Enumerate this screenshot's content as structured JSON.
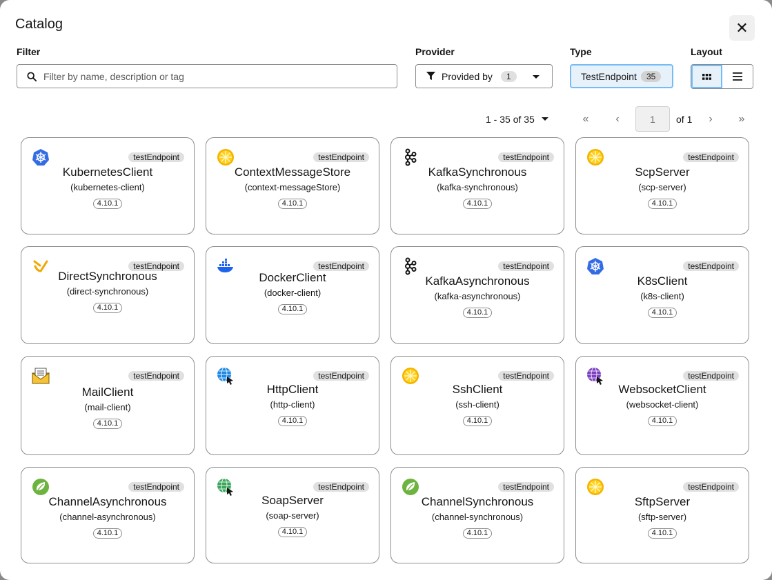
{
  "dialog": {
    "title": "Catalog",
    "close_glyph": "✕"
  },
  "filter": {
    "label": "Filter",
    "placeholder": "Filter by name, description or tag"
  },
  "provider": {
    "label": "Provider",
    "button_label": "Provided by",
    "count": "1"
  },
  "type": {
    "label": "Type",
    "selected": "TestEndpoint",
    "count": "35"
  },
  "layout": {
    "label": "Layout",
    "active": "grid"
  },
  "pagination": {
    "range": "1 - 35 of 35",
    "page": "1",
    "of_pages": "of 1",
    "first_glyph": "«",
    "prev_glyph": "‹",
    "next_glyph": "›",
    "last_glyph": "»"
  },
  "cards": [
    {
      "name": "KubernetesClient",
      "id": "(kubernetes-client)",
      "tag": "testEndpoint",
      "version": "4.10.1",
      "icon": "kubernetes-icon"
    },
    {
      "name": "ContextMessageStore",
      "id": "(context-messageStore)",
      "tag": "testEndpoint",
      "version": "4.10.1",
      "icon": "citrus-icon"
    },
    {
      "name": "KafkaSynchronous",
      "id": "(kafka-synchronous)",
      "tag": "testEndpoint",
      "version": "4.10.1",
      "icon": "kafka-icon"
    },
    {
      "name": "ScpServer",
      "id": "(scp-server)",
      "tag": "testEndpoint",
      "version": "4.10.1",
      "icon": "citrus-icon"
    },
    {
      "name": "DirectSynchronous",
      "id": "(direct-synchronous)",
      "tag": "testEndpoint",
      "version": "4.10.1",
      "icon": "direct-icon"
    },
    {
      "name": "DockerClient",
      "id": "(docker-client)",
      "tag": "testEndpoint",
      "version": "4.10.1",
      "icon": "docker-icon"
    },
    {
      "name": "KafkaAsynchronous",
      "id": "(kafka-asynchronous)",
      "tag": "testEndpoint",
      "version": "4.10.1",
      "icon": "kafka-icon"
    },
    {
      "name": "K8sClient",
      "id": "(k8s-client)",
      "tag": "testEndpoint",
      "version": "4.10.1",
      "icon": "kubernetes-icon"
    },
    {
      "name": "MailClient",
      "id": "(mail-client)",
      "tag": "testEndpoint",
      "version": "4.10.1",
      "icon": "mail-icon"
    },
    {
      "name": "HttpClient",
      "id": "(http-client)",
      "tag": "testEndpoint",
      "version": "4.10.1",
      "icon": "http-globe-icon"
    },
    {
      "name": "SshClient",
      "id": "(ssh-client)",
      "tag": "testEndpoint",
      "version": "4.10.1",
      "icon": "citrus-icon"
    },
    {
      "name": "WebsocketClient",
      "id": "(websocket-client)",
      "tag": "testEndpoint",
      "version": "4.10.1",
      "icon": "websocket-globe-icon"
    },
    {
      "name": "ChannelAsynchronous",
      "id": "(channel-asynchronous)",
      "tag": "testEndpoint",
      "version": "4.10.1",
      "icon": "spring-icon"
    },
    {
      "name": "SoapServer",
      "id": "(soap-server)",
      "tag": "testEndpoint",
      "version": "4.10.1",
      "icon": "soap-globe-icon"
    },
    {
      "name": "ChannelSynchronous",
      "id": "(channel-synchronous)",
      "tag": "testEndpoint",
      "version": "4.10.1",
      "icon": "spring-icon"
    },
    {
      "name": "SftpServer",
      "id": "(sftp-server)",
      "tag": "testEndpoint",
      "version": "4.10.1",
      "icon": "citrus-icon"
    }
  ]
}
